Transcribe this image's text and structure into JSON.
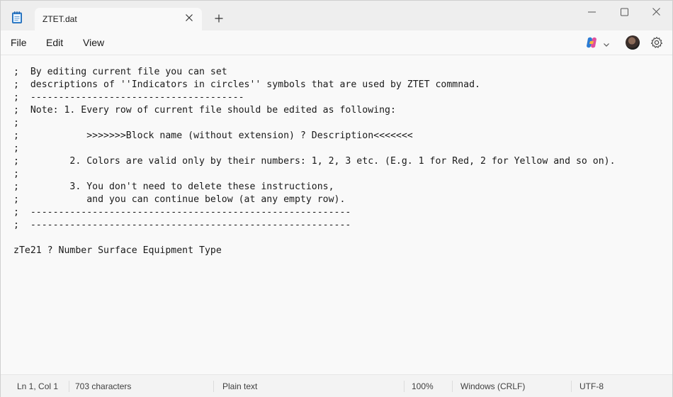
{
  "app": {
    "title": "ZTET.dat"
  },
  "menu": {
    "file": "File",
    "edit": "Edit",
    "view": "View"
  },
  "editor": {
    "lines": [
      ";  By editing current file you can set",
      ";  descriptions of ''Indicators in circles'' symbols that are used by ZTET commnad.",
      ";  --------------------------------------",
      ";  Note: 1. Every row of current file should be edited as following:",
      ";",
      ";            >>>>>>>Block name (without extension) ? Description<<<<<<<",
      ";",
      ";         2. Colors are valid only by their numbers: 1, 2, 3 etc. (E.g. 1 for Red, 2 for Yellow and so on).",
      ";",
      ";         3. You don't need to delete these instructions,",
      ";            and you can continue below (at any empty row).",
      ";  ---------------------------------------------------------",
      ";  ---------------------------------------------------------",
      "",
      "zTe21 ? Number Surface Equipment Type"
    ]
  },
  "status": {
    "position": "Ln 1, Col 1",
    "characters": "703 characters",
    "format": "Plain text",
    "zoom": "100%",
    "line_ending": "Windows (CRLF)",
    "encoding": "UTF-8"
  },
  "icons": {
    "app": "notepad-icon",
    "tab_close": "close-icon",
    "new_tab": "plus-icon",
    "minimize": "minimize-icon",
    "maximize": "maximize-icon",
    "close": "close-icon",
    "copilot": "copilot-icon",
    "settings": "gear-icon"
  },
  "colors": {
    "accent": "#2b7bd4",
    "background": "#f9f9f9",
    "titlebar": "#eeeeee"
  }
}
